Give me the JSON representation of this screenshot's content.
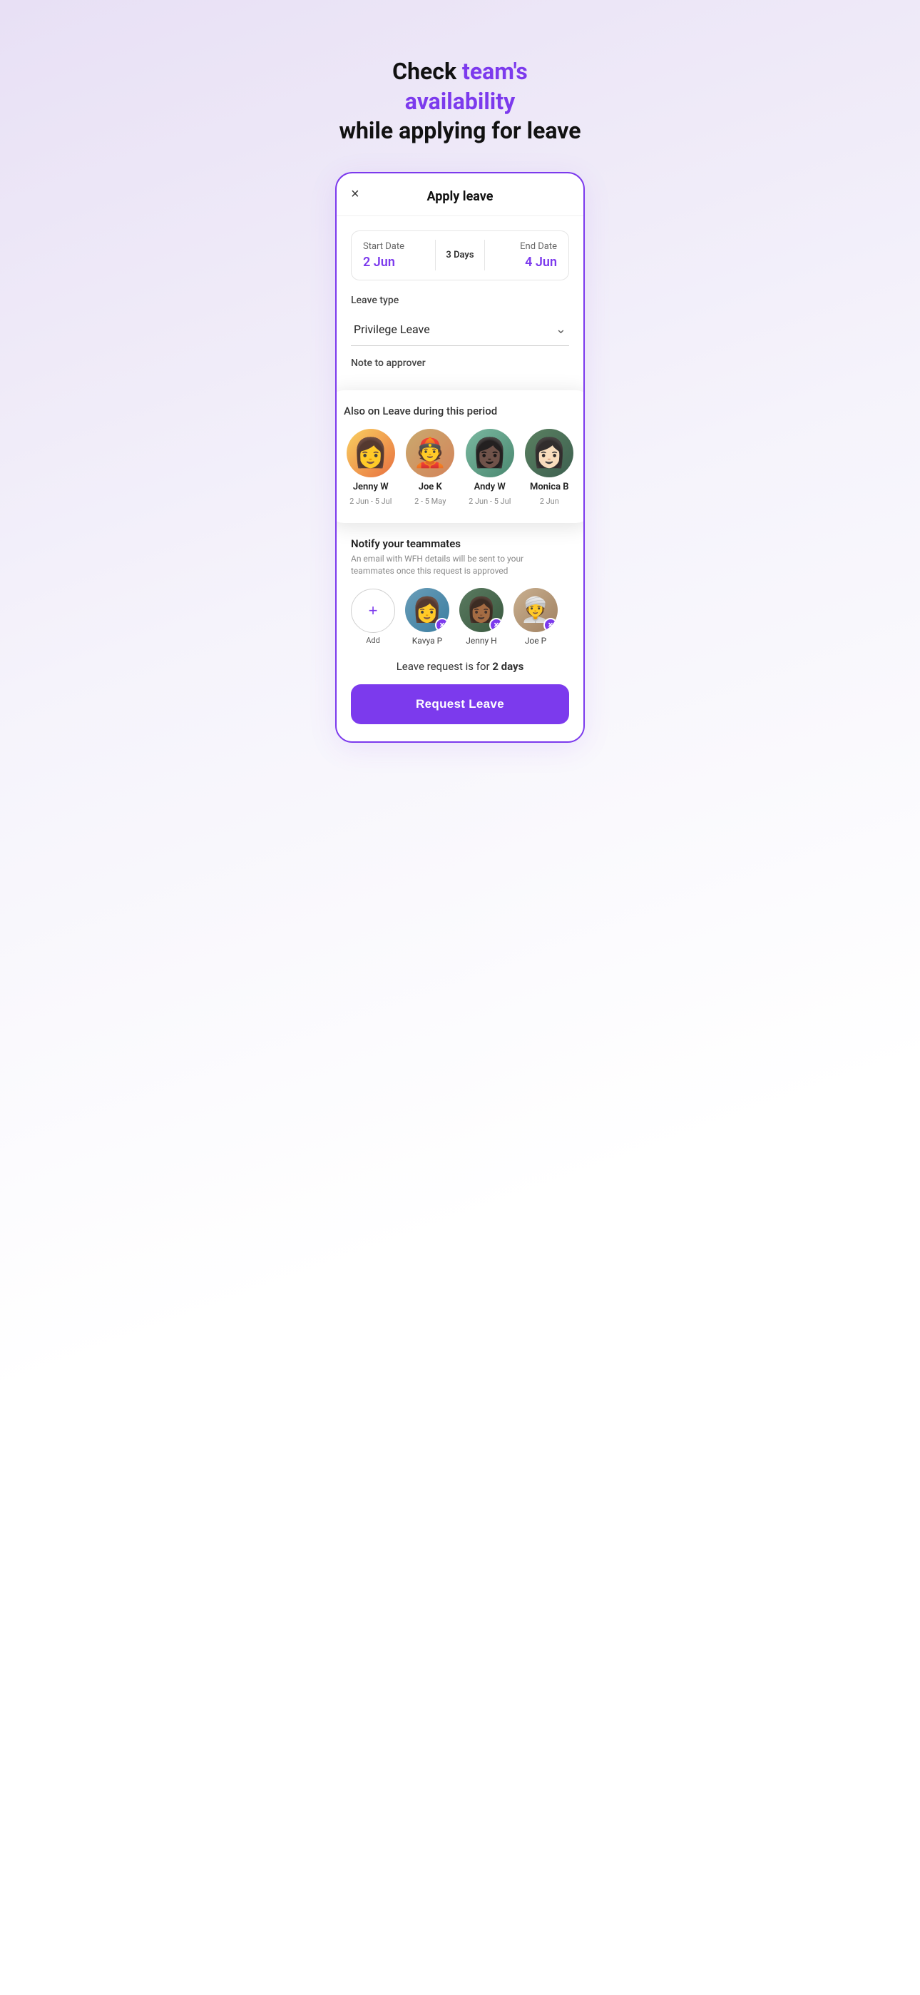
{
  "hero": {
    "line1_plain": "Check ",
    "line1_highlight": "team's availability",
    "line2": "while applying for leave"
  },
  "modal": {
    "close_icon": "×",
    "title": "Apply leave",
    "start_date_label": "Start Date",
    "start_date_value": "2 Jun",
    "days_badge": "3 Days",
    "end_date_label": "End Date",
    "end_date_value": "4 Jun",
    "leave_type_label": "Leave type",
    "leave_type_value": "Privilege Leave",
    "note_label": "Note to approver"
  },
  "also_on_leave": {
    "title": "Also on Leave during this period",
    "teammates": [
      {
        "name": "Jenny W",
        "dates": "2 Jun - 5 Jul",
        "emoji": "👩"
      },
      {
        "name": "Joe K",
        "dates": "2 - 5 May",
        "emoji": "👲"
      },
      {
        "name": "Andy W",
        "dates": "2 Jun - 5 Jul",
        "emoji": "👩🏿"
      },
      {
        "name": "Monica B",
        "dates": "2 Jun",
        "emoji": "👩🏻"
      }
    ]
  },
  "notify": {
    "title": "Notify your teammates",
    "description": "An email with WFH details will be sent to your teammates once this request is approved",
    "add_label": "Add",
    "add_plus": "+",
    "people": [
      {
        "name": "Kavya P",
        "emoji": "👩"
      },
      {
        "name": "Jenny H",
        "emoji": "👩🏾"
      },
      {
        "name": "Joe P",
        "emoji": "👳‍♀️"
      }
    ],
    "leave_summary_prefix": "Leave request is for ",
    "leave_days": "2 days",
    "request_btn_label": "Request Leave"
  }
}
